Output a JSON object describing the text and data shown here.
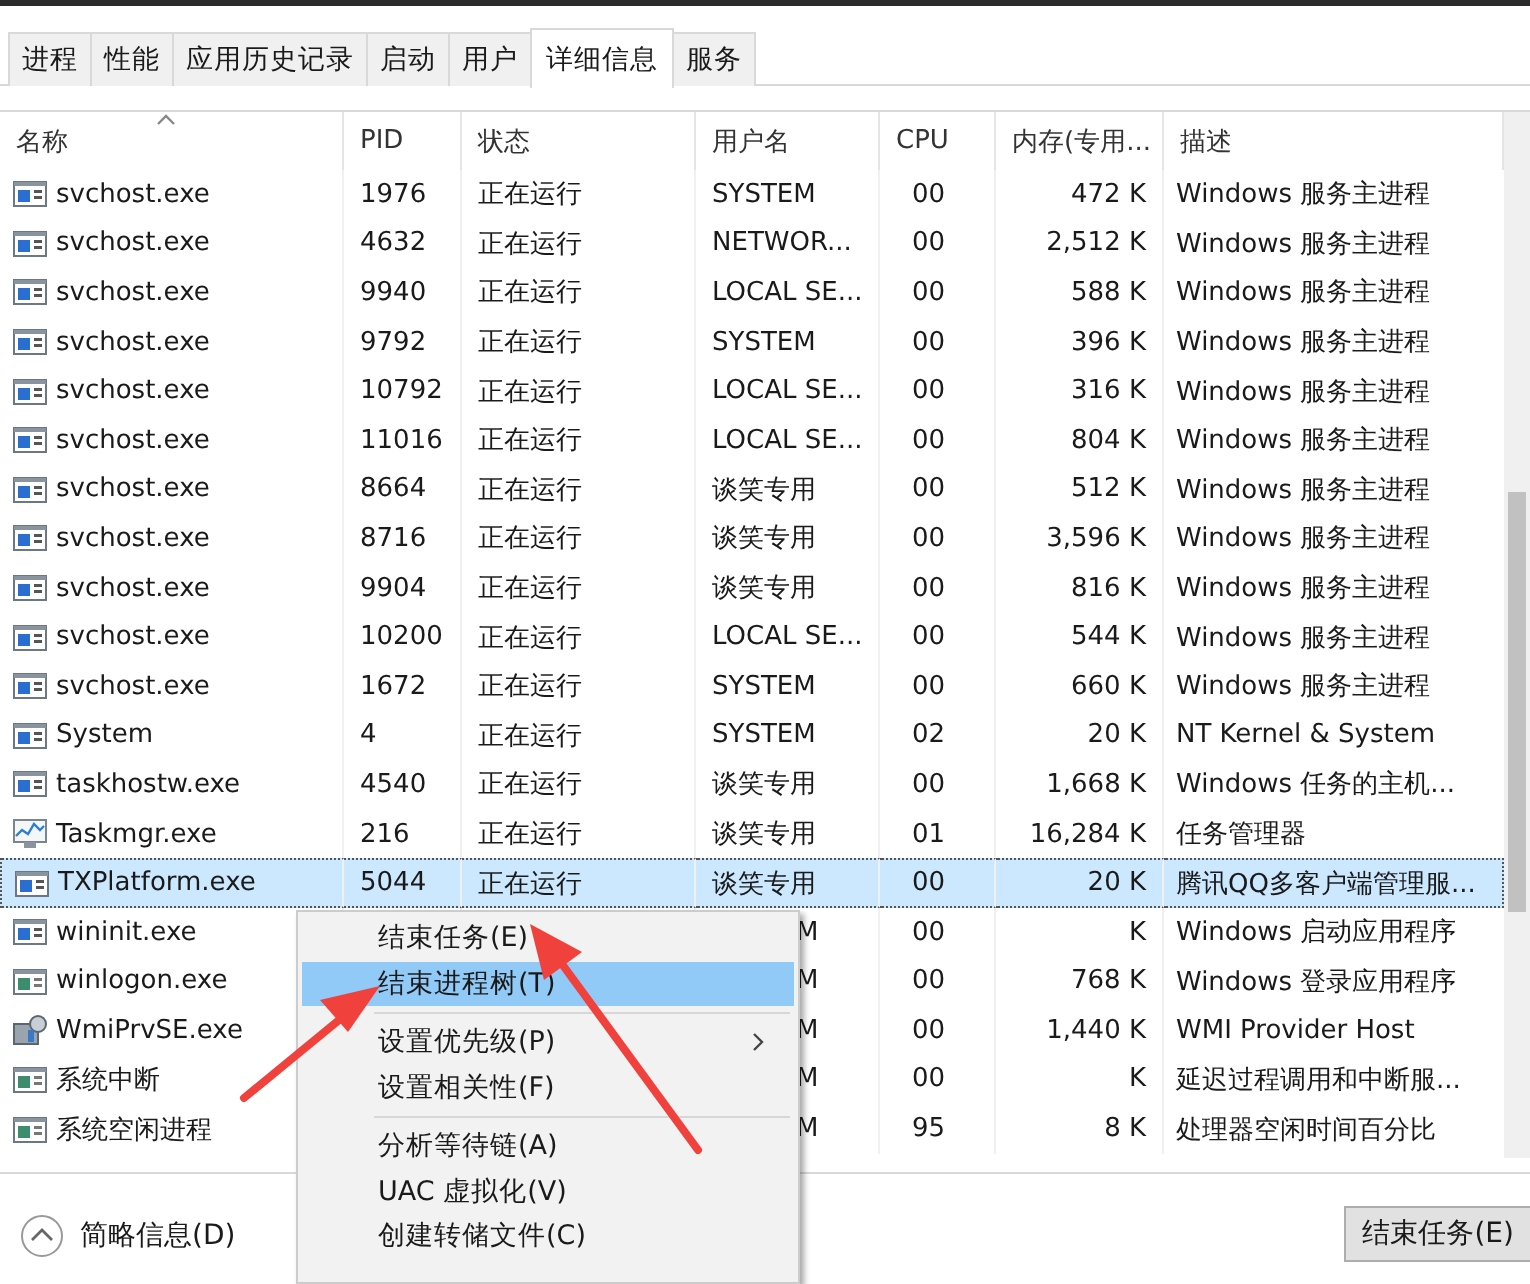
{
  "tabs": [
    {
      "label": "进程",
      "selected": false
    },
    {
      "label": "性能",
      "selected": false
    },
    {
      "label": "应用历史记录",
      "selected": false
    },
    {
      "label": "启动",
      "selected": false
    },
    {
      "label": "用户",
      "selected": false
    },
    {
      "label": "详细信息",
      "selected": true
    },
    {
      "label": "服务",
      "selected": false
    }
  ],
  "table": {
    "columns": [
      "名称",
      "PID",
      "状态",
      "用户名",
      "CPU",
      "内存(专用...",
      "描述"
    ],
    "rows": [
      {
        "name": "svchost.exe",
        "pid": "1976",
        "status": "正在运行",
        "user": "SYSTEM",
        "cpu": "00",
        "memory": "472 K",
        "description": "Windows 服务主进程",
        "selected": false
      },
      {
        "name": "svchost.exe",
        "pid": "4632",
        "status": "正在运行",
        "user": "NETWOR...",
        "cpu": "00",
        "memory": "2,512 K",
        "description": "Windows 服务主进程",
        "selected": false
      },
      {
        "name": "svchost.exe",
        "pid": "9940",
        "status": "正在运行",
        "user": "LOCAL SE...",
        "cpu": "00",
        "memory": "588 K",
        "description": "Windows 服务主进程",
        "selected": false
      },
      {
        "name": "svchost.exe",
        "pid": "9792",
        "status": "正在运行",
        "user": "SYSTEM",
        "cpu": "00",
        "memory": "396 K",
        "description": "Windows 服务主进程",
        "selected": false
      },
      {
        "name": "svchost.exe",
        "pid": "10792",
        "status": "正在运行",
        "user": "LOCAL SE...",
        "cpu": "00",
        "memory": "316 K",
        "description": "Windows 服务主进程",
        "selected": false
      },
      {
        "name": "svchost.exe",
        "pid": "11016",
        "status": "正在运行",
        "user": "LOCAL SE...",
        "cpu": "00",
        "memory": "804 K",
        "description": "Windows 服务主进程",
        "selected": false
      },
      {
        "name": "svchost.exe",
        "pid": "8664",
        "status": "正在运行",
        "user": "谈笑专用",
        "cpu": "00",
        "memory": "512 K",
        "description": "Windows 服务主进程",
        "selected": false
      },
      {
        "name": "svchost.exe",
        "pid": "8716",
        "status": "正在运行",
        "user": "谈笑专用",
        "cpu": "00",
        "memory": "3,596 K",
        "description": "Windows 服务主进程",
        "selected": false
      },
      {
        "name": "svchost.exe",
        "pid": "9904",
        "status": "正在运行",
        "user": "谈笑专用",
        "cpu": "00",
        "memory": "816 K",
        "description": "Windows 服务主进程",
        "selected": false
      },
      {
        "name": "svchost.exe",
        "pid": "10200",
        "status": "正在运行",
        "user": "LOCAL SE...",
        "cpu": "00",
        "memory": "544 K",
        "description": "Windows 服务主进程",
        "selected": false
      },
      {
        "name": "svchost.exe",
        "pid": "1672",
        "status": "正在运行",
        "user": "SYSTEM",
        "cpu": "00",
        "memory": "660 K",
        "description": "Windows 服务主进程",
        "selected": false
      },
      {
        "name": "System",
        "pid": "4",
        "status": "正在运行",
        "user": "SYSTEM",
        "cpu": "02",
        "memory": "20 K",
        "description": "NT Kernel & System",
        "selected": false
      },
      {
        "name": "taskhostw.exe",
        "pid": "4540",
        "status": "正在运行",
        "user": "谈笑专用",
        "cpu": "00",
        "memory": "1,668 K",
        "description": "Windows 任务的主机...",
        "selected": false
      },
      {
        "name": "Taskmgr.exe",
        "pid": "216",
        "status": "正在运行",
        "user": "谈笑专用",
        "cpu": "01",
        "memory": "16,284 K",
        "description": "任务管理器",
        "selected": false
      },
      {
        "name": "TXPlatform.exe",
        "pid": "5044",
        "status": "正在运行",
        "user": "谈笑专用",
        "cpu": "00",
        "memory": "20 K",
        "description": "腾讯QQ多客户端管理服...",
        "selected": true
      },
      {
        "name": "wininit.exe",
        "user": "M",
        "cpu": "00",
        "memory": "K",
        "description": "Windows 启动应用程序",
        "selected": false
      },
      {
        "name": "winlogon.exe",
        "user": "M",
        "cpu": "00",
        "memory": "768 K",
        "description": "Windows 登录应用程序",
        "selected": false
      },
      {
        "name": "WmiPrvSE.exe",
        "user": "M",
        "cpu": "00",
        "memory": "1,440 K",
        "description": "WMI Provider Host",
        "selected": false
      },
      {
        "name": "系统中断",
        "user": "M",
        "cpu": "00",
        "memory": "K",
        "description": "延迟过程调用和中断服...",
        "selected": false
      },
      {
        "name": "系统空闲进程",
        "user": "M",
        "cpu": "95",
        "memory": "8 K",
        "description": "处理器空闲时间百分比",
        "selected": false
      }
    ]
  },
  "context_menu": {
    "groups": [
      [
        {
          "label": "结束任务(E)",
          "selected": false,
          "submenu": false
        },
        {
          "label": "结束进程树(T)",
          "selected": true,
          "submenu": false
        }
      ],
      [
        {
          "label": "设置优先级(P)",
          "selected": false,
          "submenu": true
        },
        {
          "label": "设置相关性(F)",
          "selected": false,
          "submenu": false
        }
      ],
      [
        {
          "label": "分析等待链(A)",
          "selected": false,
          "submenu": false
        },
        {
          "label": "UAC 虚拟化(V)",
          "selected": false,
          "submenu": false
        },
        {
          "label": "创建转储文件(C)",
          "selected": false,
          "submenu": false
        }
      ]
    ]
  },
  "footer": {
    "fewer_details": "简略信息(D)",
    "end_task": "结束任务(E)"
  }
}
